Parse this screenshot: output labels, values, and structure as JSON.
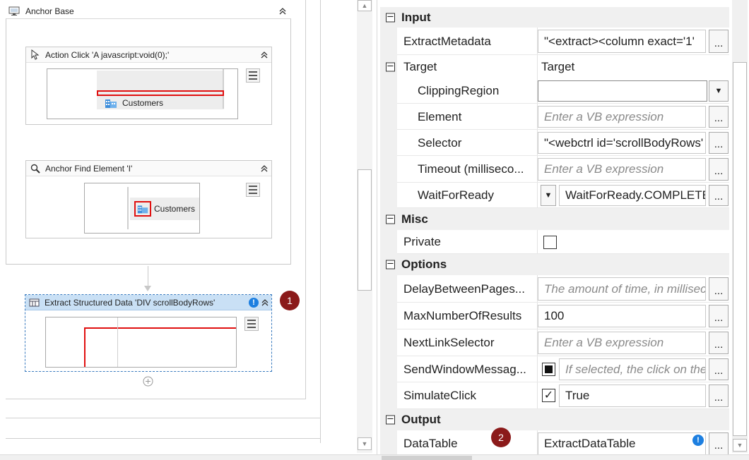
{
  "designer": {
    "sequence_title": "Anchor Base",
    "action_click_title": "Action Click 'A  javascript:void(0);'",
    "action_click_preview_label": "Customers",
    "anchor_find_title": "Anchor Find Element 'I'",
    "anchor_find_preview_label": "Customers",
    "extract_title": "Extract Structured Data 'DIV  scrollBodyRows'",
    "badge_1": "1",
    "badge_2": "2",
    "info_glyph": "!"
  },
  "properties": {
    "cat_input": "Input",
    "extract_metadata_name": "ExtractMetadata",
    "extract_metadata_value": "\"<extract><column exact='1'",
    "target_name": "Target",
    "target_value": "Target",
    "clipping_region_name": "ClippingRegion",
    "clipping_region_value": "",
    "element_name": "Element",
    "element_placeholder": "Enter a VB expression",
    "selector_name": "Selector",
    "selector_value": "\"<webctrl id='scrollBodyRows'",
    "timeout_name": "Timeout (milliseco...",
    "timeout_placeholder": "Enter a VB expression",
    "waitforready_name": "WaitForReady",
    "waitforready_value": "WaitForReady.COMPLETE",
    "cat_misc": "Misc",
    "private_name": "Private",
    "private_checked": false,
    "cat_options": "Options",
    "delay_name": "DelayBetweenPages...",
    "delay_placeholder": "The amount of time, in milliseconds",
    "maxresults_name": "MaxNumberOfResults",
    "maxresults_value": "100",
    "nextlink_name": "NextLinkSelector",
    "nextlink_placeholder": "Enter a VB expression",
    "sendwindow_name": "SendWindowMessag...",
    "sendwindow_placeholder": "If selected, the click on the",
    "sendwindow_state": "indeterminate",
    "simulateclick_name": "SimulateClick",
    "simulateclick_value": "True",
    "simulateclick_checked": true,
    "cat_output": "Output",
    "datatable_name": "DataTable",
    "datatable_value": "ExtractDataTable",
    "ellipsis": "...",
    "expand_glyph": "−",
    "check_glyph": "✓"
  },
  "icons": {
    "sequence": "sequence-icon",
    "click": "cursor-icon",
    "find": "magnifier-icon",
    "extract": "table-extract-icon",
    "building": "building-icon",
    "add": "add-circle-icon",
    "warning": "info-icon"
  },
  "colors": {
    "badge": "#8b1a1a",
    "selection": "#c9e0f5",
    "selection_border": "#3a7bbf",
    "red_outline": "#e01010",
    "info_blue": "#1d7fe0"
  }
}
